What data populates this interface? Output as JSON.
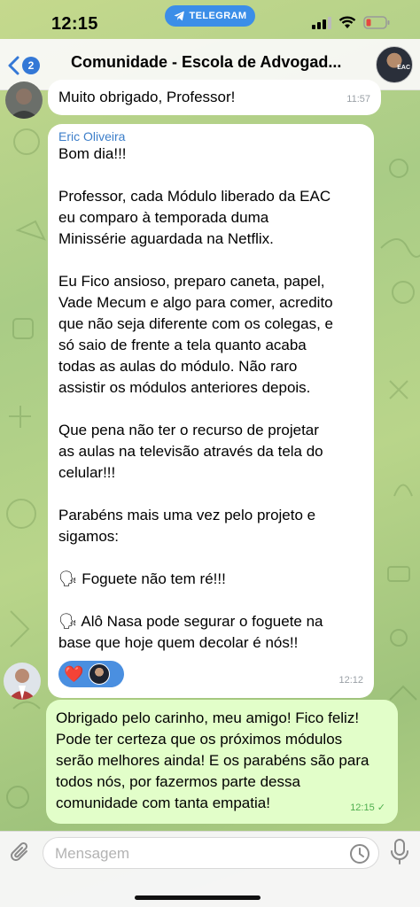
{
  "status_bar": {
    "time": "12:15",
    "pill_label": "TELEGRAM",
    "battery_color": "#e5483f"
  },
  "header": {
    "back_count": "2",
    "title": "Comunidade - Escola de Advogad...",
    "avatar_text": "EAC"
  },
  "messages": [
    {
      "type": "in",
      "text": "Muito obrigado, Professor!",
      "time": "11:57"
    },
    {
      "type": "in",
      "sender": "Eric Oliveira",
      "lines": [
        "Bom dia!!!",
        "",
        "Professor, cada Módulo liberado da EAC",
        "eu comparo à temporada duma",
        "Minissérie aguardada na Netflix.",
        "",
        "Eu Fico ansioso, preparo caneta, papel,",
        "Vade Mecum e algo para comer, acredito",
        "que não seja diferente com os colegas, e",
        "só saio de frente a tela quanto acaba",
        "todas as aulas do módulo. Não raro",
        "assistir os módulos anteriores depois.",
        "",
        "Que pena não ter o recurso de projetar",
        "as aulas na televisão através da tela do",
        "celular!!!",
        "",
        "Parabéns mais uma vez pelo projeto e",
        "sigamos:",
        "",
        "🗣 Foguete não tem ré!!!",
        "",
        "🗣 Alô Nasa pode segurar o foguete na",
        "base que hoje quem decolar é nós!!"
      ],
      "reaction": "❤️",
      "time": "12:12"
    },
    {
      "type": "out",
      "lines": [
        "Obrigado pelo carinho, meu amigo! Fico feliz!",
        "Pode ter certeza que os próximos módulos",
        "serão melhores ainda! E os parabéns são para",
        "todos nós, por fazermos parte dessa",
        "comunidade com tanta empatia!"
      ],
      "time": "12:15",
      "status": "✓"
    }
  ],
  "input": {
    "placeholder": "Mensagem"
  },
  "colors": {
    "accent": "#3478d6",
    "out_bubble": "#e2fec9",
    "sender": "#3c7ec9"
  }
}
